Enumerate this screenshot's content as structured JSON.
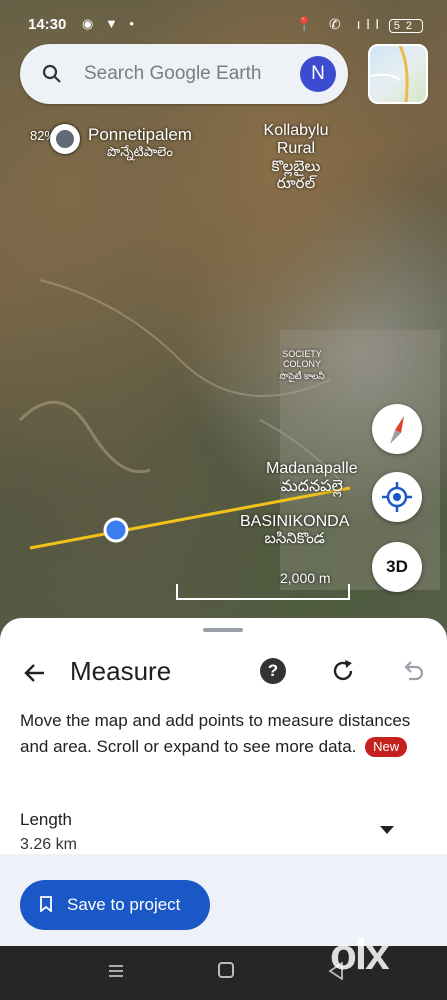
{
  "status_bar": {
    "time": "14:30",
    "left_icons": "◉ ▼ •",
    "right_icons": "📍 ✆ ıll",
    "battery": "52"
  },
  "search": {
    "placeholder": "Search Google Earth",
    "avatar_initial": "N"
  },
  "map": {
    "poi_percent": "82%",
    "places": [
      {
        "name": "Ponnetipalem",
        "native": "పొన్నేటిపాలెం"
      },
      {
        "name": "Kollabylu Rural",
        "native": "కొల్లబైలు రూరల్"
      },
      {
        "name": "SOCIETY COLONY",
        "native": "సొసైటీ కాలనీ"
      },
      {
        "name": "Madanapalle",
        "native": "మదనపల్లె"
      },
      {
        "name": "BASINIKONDA",
        "native": "బసినికొండ"
      }
    ],
    "scale_label": "2,000 m",
    "button_3d": "3D"
  },
  "measure": {
    "title": "Measure",
    "help": "?",
    "description": "Move the map and add points to measure distances and area. Scroll or expand to see more data.",
    "new_badge": "New",
    "length_label": "Length",
    "length_value": "3.26 km",
    "save_button": "Save to project"
  },
  "watermark": "olx",
  "colors": {
    "accent": "#1a57c7",
    "badge": "#c5221f",
    "avatar": "#3d4bd1",
    "measure_line": "#f2c21b",
    "point": "#3b7cf0"
  }
}
